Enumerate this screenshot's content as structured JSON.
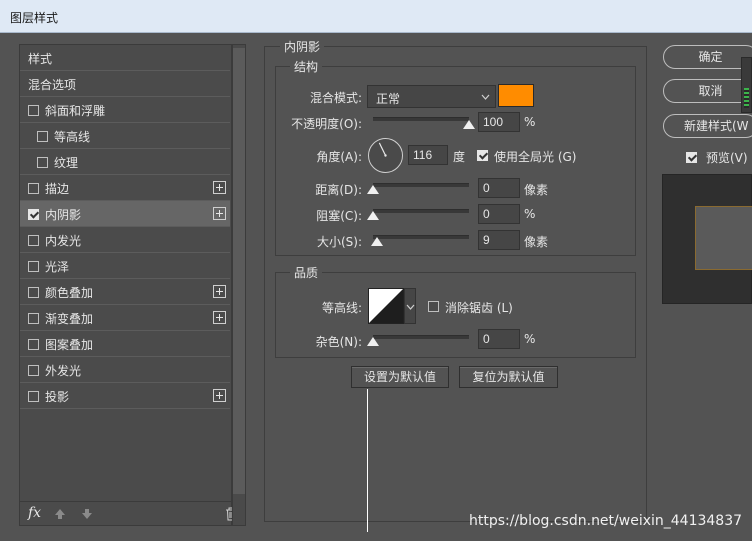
{
  "window_title": "图层样式",
  "left_panel": {
    "items": [
      {
        "label": "样式",
        "checkbox": false,
        "checked": false,
        "plus": false,
        "selected": false,
        "indent": 0
      },
      {
        "label": "混合选项",
        "checkbox": false,
        "checked": false,
        "plus": false,
        "selected": false,
        "indent": 0
      },
      {
        "label": "斜面和浮雕",
        "checkbox": true,
        "checked": false,
        "plus": false,
        "selected": false,
        "indent": 0
      },
      {
        "label": "等高线",
        "checkbox": true,
        "checked": false,
        "plus": false,
        "selected": false,
        "indent": 1
      },
      {
        "label": "纹理",
        "checkbox": true,
        "checked": false,
        "plus": false,
        "selected": false,
        "indent": 1
      },
      {
        "label": "描边",
        "checkbox": true,
        "checked": false,
        "plus": true,
        "selected": false,
        "indent": 0
      },
      {
        "label": "内阴影",
        "checkbox": true,
        "checked": true,
        "plus": true,
        "selected": true,
        "indent": 0
      },
      {
        "label": "内发光",
        "checkbox": true,
        "checked": false,
        "plus": false,
        "selected": false,
        "indent": 0
      },
      {
        "label": "光泽",
        "checkbox": true,
        "checked": false,
        "plus": false,
        "selected": false,
        "indent": 0
      },
      {
        "label": "颜色叠加",
        "checkbox": true,
        "checked": false,
        "plus": true,
        "selected": false,
        "indent": 0
      },
      {
        "label": "渐变叠加",
        "checkbox": true,
        "checked": false,
        "plus": true,
        "selected": false,
        "indent": 0
      },
      {
        "label": "图案叠加",
        "checkbox": true,
        "checked": false,
        "plus": false,
        "selected": false,
        "indent": 0
      },
      {
        "label": "外发光",
        "checkbox": true,
        "checked": false,
        "plus": false,
        "selected": false,
        "indent": 0
      },
      {
        "label": "投影",
        "checkbox": true,
        "checked": false,
        "plus": true,
        "selected": false,
        "indent": 0
      }
    ],
    "footer": {
      "fx": "fx"
    }
  },
  "inner_shadow": {
    "section_title": "内阴影",
    "structure": {
      "title": "结构",
      "blend_mode_label": "混合模式:",
      "blend_mode_value": "正常",
      "blend_color": "#ff8c00",
      "opacity_label": "不透明度(O):",
      "opacity_value": "100",
      "opacity_fraction": 1.0,
      "angle_label": "角度(A):",
      "angle_value": "116",
      "angle_unit": "度",
      "global_light_label": "使用全局光 (G)",
      "global_light_checked": true,
      "distance_label": "距离(D):",
      "distance_value": "0",
      "distance_fraction": 0.0,
      "choke_label": "阻塞(C):",
      "choke_value": "0",
      "choke_fraction": 0.0,
      "size_label": "大小(S):",
      "size_value": "9",
      "size_fraction": 0.04,
      "unit_pixels": "像素",
      "unit_percent": "%"
    },
    "quality": {
      "title": "品质",
      "contour_label": "等高线:",
      "antialias_label": "消除锯齿 (L)",
      "antialias_checked": false,
      "noise_label": "杂色(N):",
      "noise_value": "0",
      "noise_fraction": 0.0,
      "unit_percent": "%"
    },
    "buttons": {
      "set_default": "设置为默认值",
      "reset_default": "复位为默认值"
    }
  },
  "right_panel": {
    "ok": "确定",
    "cancel": "取消",
    "new_style": "新建样式(W",
    "preview_label": "预览(V)",
    "preview_checked": true
  },
  "watermark": "https://blog.csdn.net/weixin_44134837"
}
